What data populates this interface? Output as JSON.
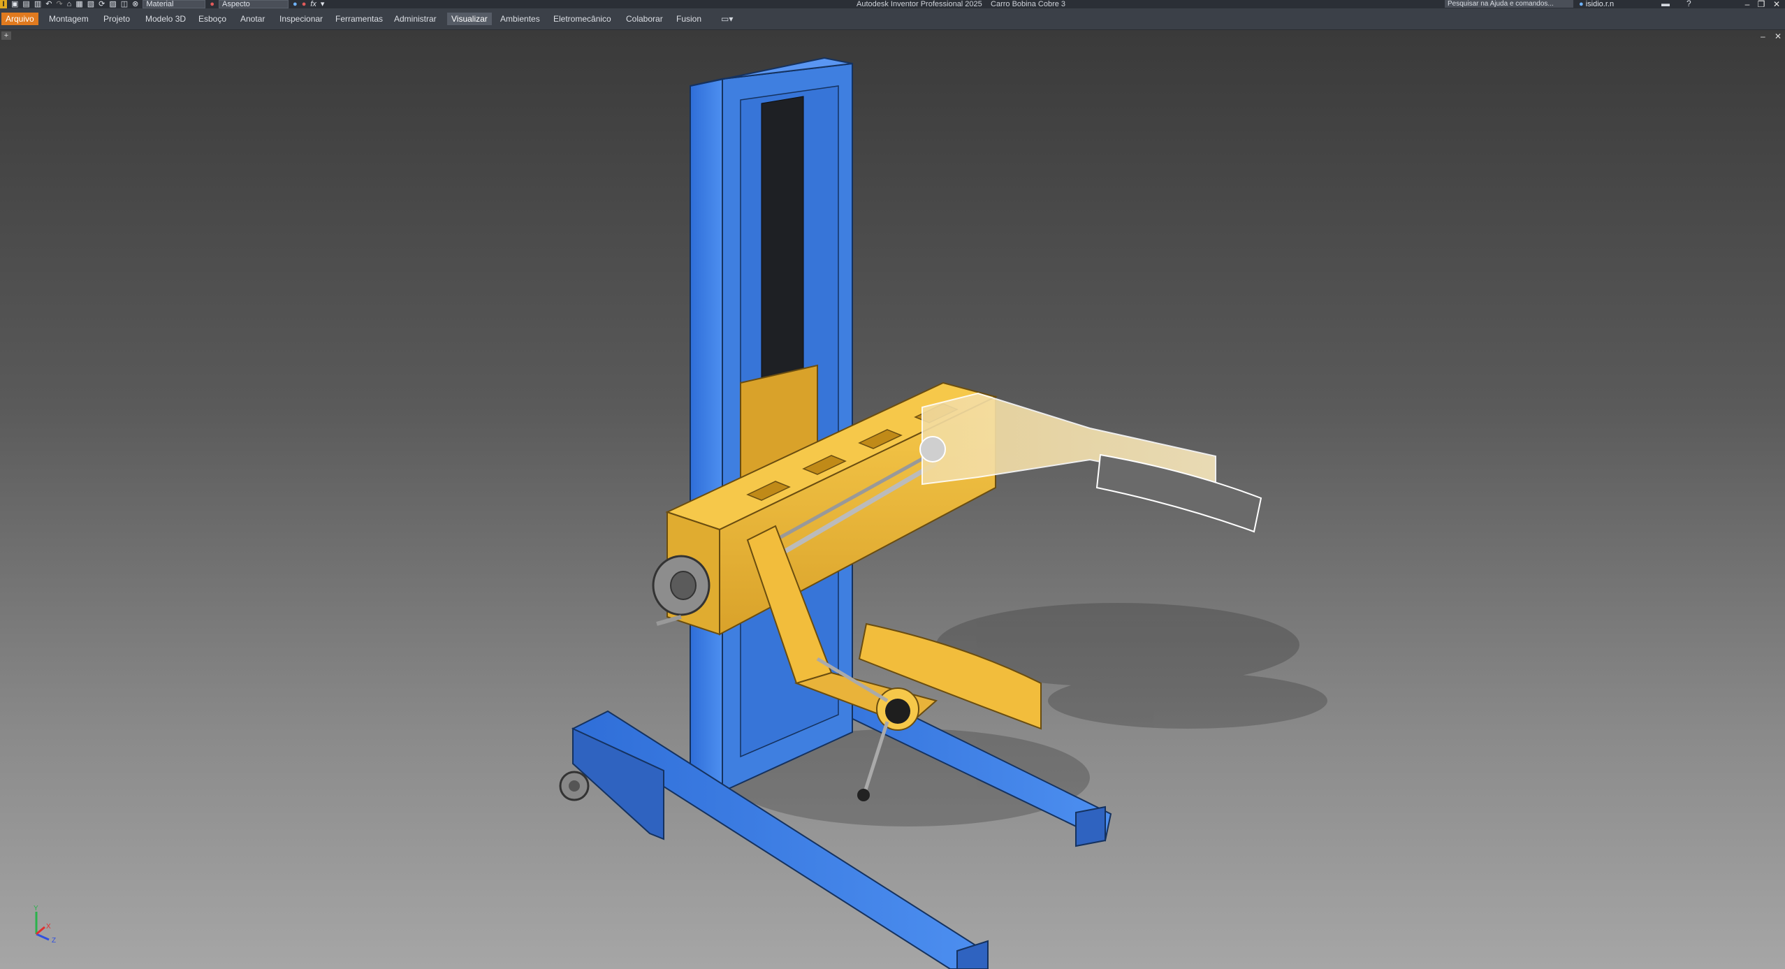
{
  "app": {
    "logo_letter": "I",
    "title": "Autodesk Inventor Professional 2025",
    "document": "Carro Bobina Cobre 3"
  },
  "quick_access": {
    "material_placeholder": "Material",
    "appearance_placeholder": "Aspecto",
    "fx_label": "fx"
  },
  "search": {
    "placeholder": "Pesquisar na Ajuda e comandos..."
  },
  "user": {
    "name": "isidio.r.n"
  },
  "ribbon": {
    "tabs": [
      {
        "label": "Arquivo"
      },
      {
        "label": "Montagem"
      },
      {
        "label": "Projeto"
      },
      {
        "label": "Modelo 3D"
      },
      {
        "label": "Esboço"
      },
      {
        "label": "Anotar"
      },
      {
        "label": "Inspecionar"
      },
      {
        "label": "Ferramentas"
      },
      {
        "label": "Administrar"
      },
      {
        "label": "Visualizar"
      },
      {
        "label": "Ambientes"
      },
      {
        "label": "Eletromecânico"
      },
      {
        "label": "Colaborar"
      },
      {
        "label": "Fusion"
      }
    ],
    "active_tab": "Visualizar"
  },
  "triad": {
    "x": "X",
    "y": "Y",
    "z": "Z"
  },
  "colors": {
    "frame_blue": "#3f7fe0",
    "arm_yellow": "#f0b93a",
    "file_tab": "#e07a1f"
  }
}
